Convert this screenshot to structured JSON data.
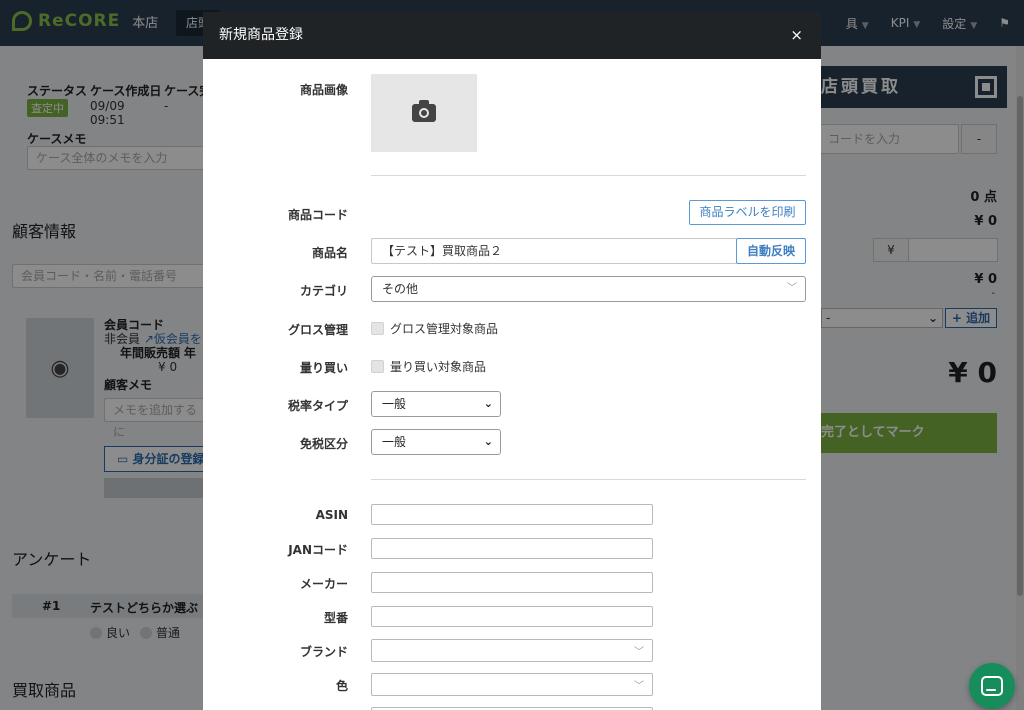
{
  "app": {
    "logo_text": "ReCORE",
    "store_name": "本店",
    "store_tab": "店頭",
    "nav": [
      {
        "label": "具"
      },
      {
        "label": "KPI"
      },
      {
        "label": "設定"
      }
    ]
  },
  "left_panel": {
    "status_label": "ステータス",
    "status_value": "査定中",
    "created_label": "ケース作成日",
    "created_date": "09/09",
    "created_time": "09:51",
    "completed_label": "ケース完",
    "completed_value": "-",
    "memo_label": "ケースメモ",
    "memo_placeholder": "ケース全体のメモを入力",
    "customer_title": "顧客情報",
    "customer_search_placeholder": "会員コード・名前・電話番号",
    "member_code_label": "会員コード",
    "member_type": "非会員",
    "temp_member_link": "仮会員を",
    "annual_sales_label": "年間販売額",
    "annual_label_short": "年",
    "annual_sales_value": "¥ 0",
    "customer_memo_label": "顧客メモ",
    "customer_memo_placeholder": "メモを追加するに",
    "id_register_button": "身分証の登録",
    "survey_title": "アンケート",
    "survey_number": "#1",
    "survey_question": "テストどちらか選ぶ",
    "survey_options": [
      "良い",
      "普通"
    ],
    "purchase_title": "買取商品"
  },
  "right_panel": {
    "header": "店頭買取",
    "code_placeholder": "コードを入力",
    "minus_button": "-",
    "count_value": "0 点",
    "amount_1": "¥ 0",
    "yen_symbol": "¥",
    "amount_2": "¥ 0",
    "dash": "-",
    "select_value": "-",
    "add_button": "+ 追加",
    "total_value": "¥ 0",
    "complete_button": "完了としてマーク"
  },
  "modal": {
    "title": "新規商品登録",
    "close": "×",
    "product_image_label": "商品画像",
    "product_code_label": "商品コード",
    "print_label_button": "商品ラベルを印刷",
    "product_name_label": "商品名",
    "product_name_value": "【テスト】買取商品２",
    "auto_reflect_button": "自動反映",
    "category_label": "カテゴリ",
    "category_value": "その他",
    "gross_label": "グロス管理",
    "gross_checkbox_label": "グロス管理対象商品",
    "bulk_label": "量り買い",
    "bulk_checkbox_label": "量り買い対象商品",
    "tax_type_label": "税率タイプ",
    "tax_type_value": "一般",
    "tax_exempt_label": "免税区分",
    "tax_exempt_value": "一般",
    "asin_label": "ASIN",
    "jan_label": "JANコード",
    "maker_label": "メーカー",
    "model_label": "型番",
    "brand_label": "ブランド",
    "color_label": "色"
  }
}
